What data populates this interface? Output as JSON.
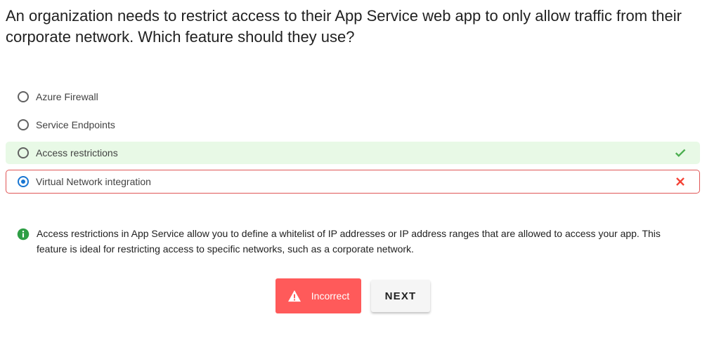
{
  "question": "An organization needs to restrict access to their App Service web app to only allow traffic from their corporate network. Which feature should they use?",
  "options": [
    {
      "label": "Azure Firewall",
      "state": "default",
      "selected": false
    },
    {
      "label": "Service Endpoints",
      "state": "default",
      "selected": false
    },
    {
      "label": "Access restrictions",
      "state": "correct",
      "selected": false,
      "mark_icon": "check-icon"
    },
    {
      "label": "Virtual Network integration",
      "state": "wrong",
      "selected": true,
      "mark_icon": "x-icon"
    }
  ],
  "explanation": {
    "icon": "info-icon",
    "text": "Access restrictions in App Service allow you to define a whitelist of IP addresses or IP address ranges that are allowed to access your app. This feature is ideal for restricting access to specific networks, such as a corporate network."
  },
  "result_button": {
    "label": "Incorrect",
    "icon": "warning-icon"
  },
  "next_button": {
    "label": "NEXT"
  },
  "colors": {
    "correct_bg": "#e8f9e6",
    "correct_check": "#4caf50",
    "wrong_border": "#e05656",
    "wrong_x": "#f44336",
    "radio_selected": "#1976d2",
    "incorrect_button": "#ff5a5a",
    "info": "#2e9e45"
  }
}
